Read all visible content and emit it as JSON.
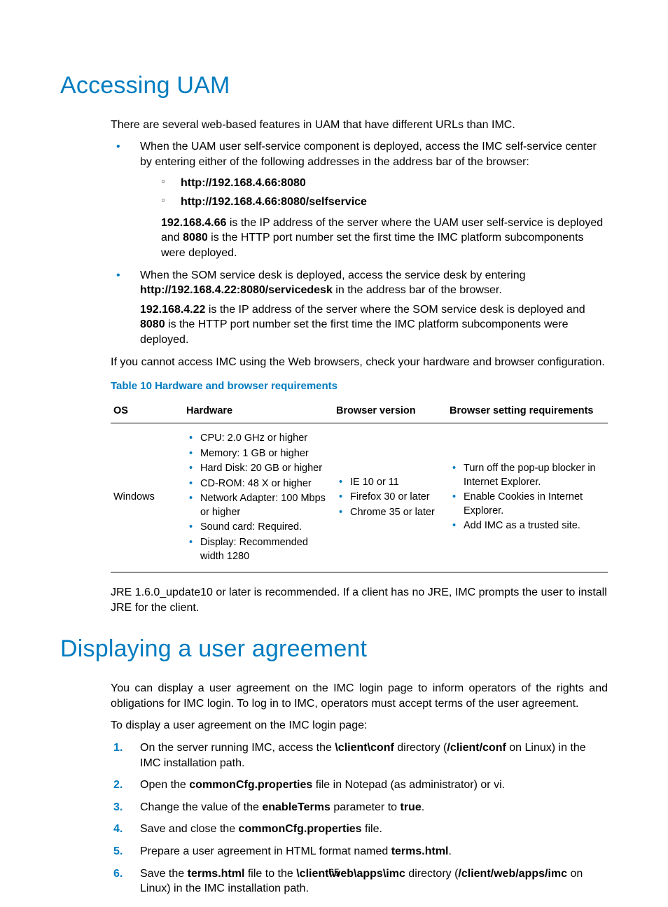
{
  "h1a": "Accessing UAM",
  "intro": "There are several web-based features in UAM that have different URLs than IMC.",
  "b1_pre": "When the UAM user self-service component is deployed, access the IMC self-service center by entering either of the following addresses in the address bar of the browser:",
  "url1": "http://192.168.4.66:8080",
  "url2": "http://192.168.4.66:8080/selfservice",
  "b1_sub_ip": "192.168.4.66",
  "b1_sub_mid": " is the IP address of the server where the UAM user self-service is deployed and ",
  "b1_sub_port": "8080",
  "b1_sub_end": " is the HTTP port number set the first time the IMC platform subcomponents were deployed.",
  "b2_pre": "When the SOM service desk is deployed, access the service desk by entering ",
  "b2_url": "http://192.168.4.22:8080/servicedesk",
  "b2_post": " in the address bar of the browser.",
  "b2_sub_ip": "192.168.4.22",
  "b2_sub_mid": " is the IP address of the server where the SOM service desk is deployed and ",
  "b2_sub_port": "8080",
  "b2_sub_end": " is the HTTP port number set the first time the IMC platform subcomponents were deployed.",
  "cannot": "If you cannot access IMC using the Web browsers, check your hardware and browser configuration.",
  "table_caption": "Table 10 Hardware and browser requirements",
  "th": {
    "os": "OS",
    "hw": "Hardware",
    "bv": "Browser version",
    "bs": "Browser setting requirements"
  },
  "row_os": "Windows",
  "hw": [
    "CPU: 2.0 GHz or higher",
    "Memory: 1 GB or higher",
    "Hard Disk: 20 GB or higher",
    "CD-ROM: 48 X or higher",
    "Network Adapter: 100 Mbps or higher",
    "Sound card: Required.",
    "Display: Recommended width 1280"
  ],
  "bv": [
    "IE 10 or 11",
    "Firefox 30 or later",
    "Chrome 35 or later"
  ],
  "bs": [
    "Turn off the pop-up blocker in Internet Explorer.",
    "Enable Cookies in Internet Explorer.",
    "Add IMC as a trusted site."
  ],
  "jre": "JRE 1.6.0_update10 or later is recommended. If a client has no JRE, IMC prompts the user to install JRE for the client.",
  "h1b": "Displaying a user agreement",
  "ua_intro": "You can display a user agreement on the IMC login page to inform operators of the rights and obligations for IMC login. To log in to IMC, operators must accept terms of the user agreement.",
  "ua_lead": "To display a user agreement on the IMC login page:",
  "s1_a": "On the server running IMC, access the ",
  "s1_b": "\\client\\conf",
  "s1_c": " directory (",
  "s1_d": "/client/conf",
  "s1_e": " on Linux) in the IMC installation path.",
  "s2_a": "Open the ",
  "s2_b": "commonCfg.properties",
  "s2_c": " file in Notepad (as administrator) or vi.",
  "s3_a": "Change the value of the ",
  "s3_b": "enableTerms",
  "s3_c": " parameter to ",
  "s3_d": "true",
  "s3_e": ".",
  "s4_a": "Save and close the ",
  "s4_b": "commonCfg.properties",
  "s4_c": " file.",
  "s5_a": "Prepare a user agreement in HTML format named ",
  "s5_b": "terms.html",
  "s5_c": ".",
  "s6_a": "Save the ",
  "s6_b": "terms.html",
  "s6_c": " file to the ",
  "s6_d": "\\client\\web\\apps\\imc",
  "s6_e": " directory (",
  "s6_f": "/client/web/apps/imc",
  "s6_g": " on Linux) in the IMC installation path.",
  "page": "65"
}
